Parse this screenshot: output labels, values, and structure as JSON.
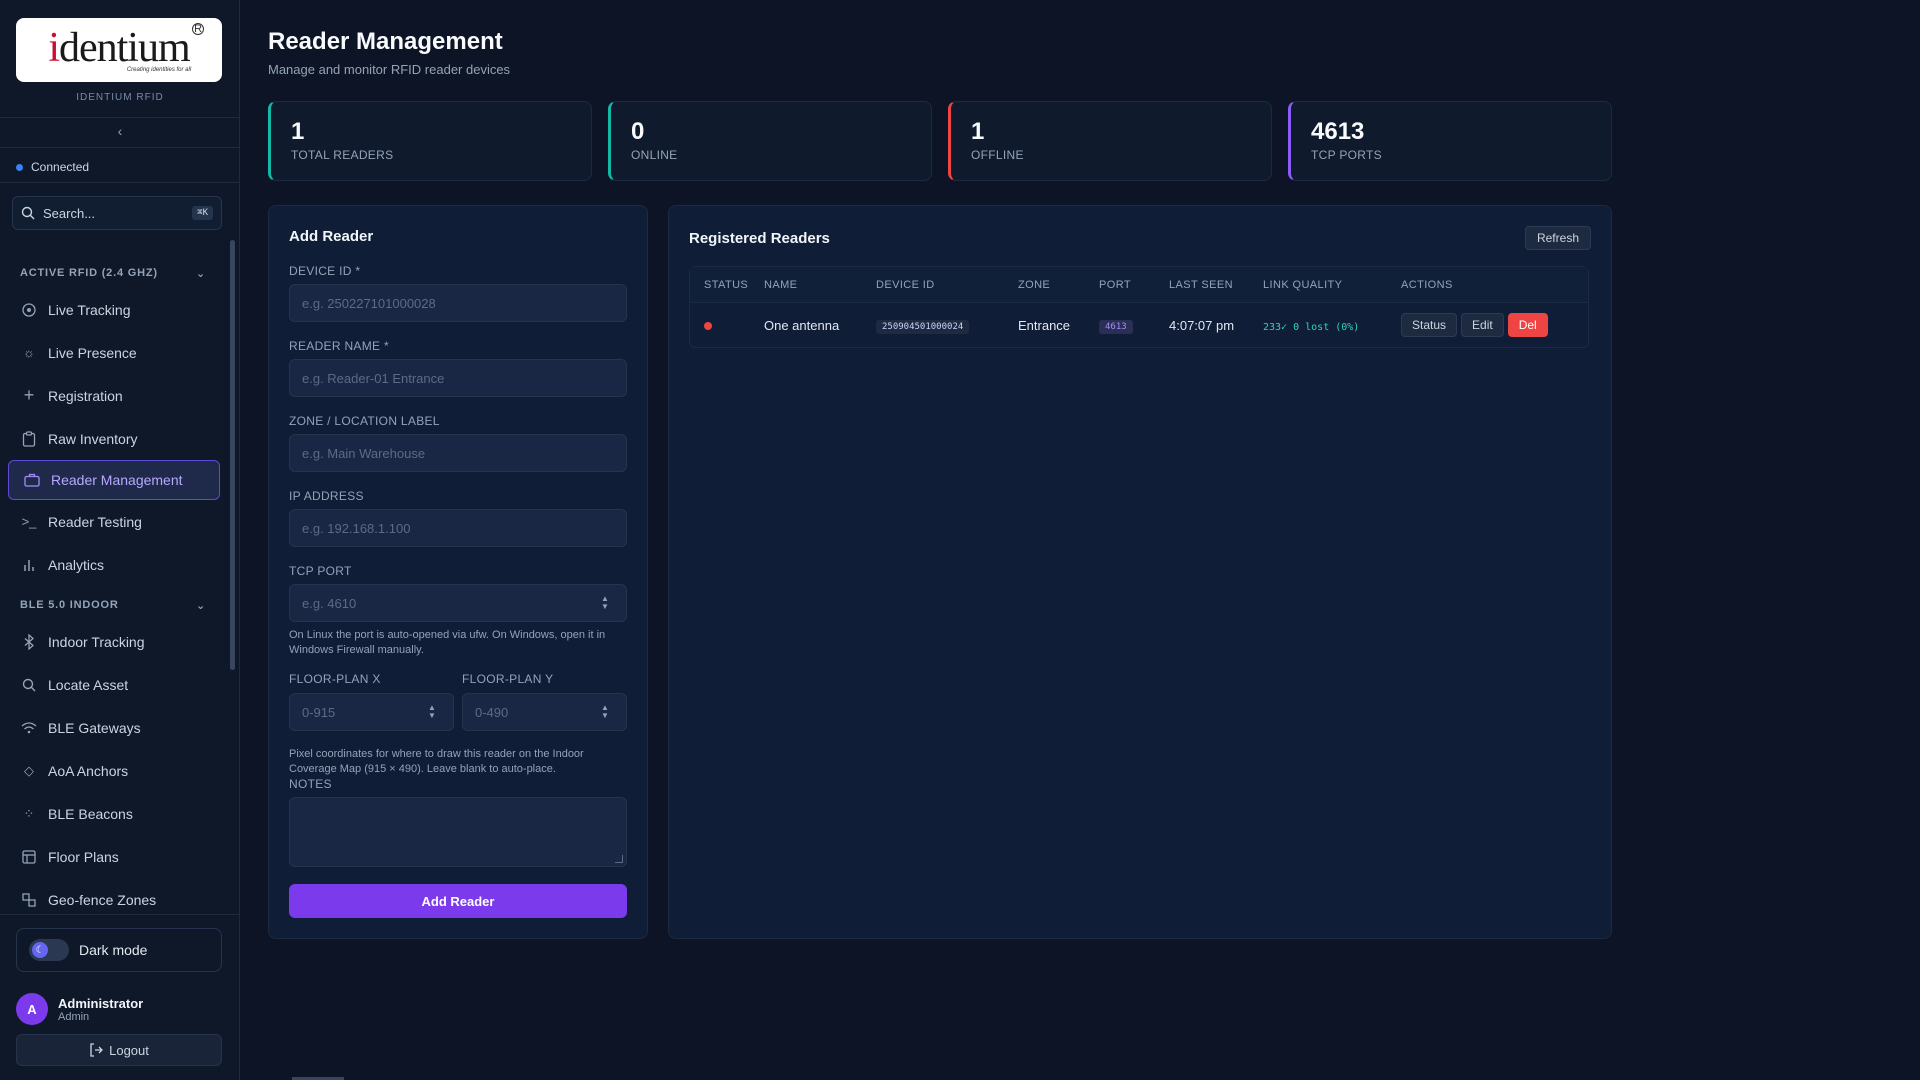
{
  "brand": {
    "logo_prefix": "i",
    "logo_rest": "dentium",
    "logo_reg": "R",
    "tagline": "Creating identities for all",
    "subtitle": "IDENTIUM RFID"
  },
  "sidebar": {
    "collapse_icon": "‹",
    "connection": "Connected",
    "search": {
      "placeholder": "Search...",
      "shortcut": "⌘K"
    },
    "sections": [
      {
        "title": "ACTIVE RFID (2.4 GHZ)",
        "items": [
          {
            "label": "Live Tracking",
            "icon": "radar-icon"
          },
          {
            "label": "Live Presence",
            "icon": "sun-icon"
          },
          {
            "label": "Registration",
            "icon": "plus-icon"
          },
          {
            "label": "Raw Inventory",
            "icon": "clipboard-icon"
          },
          {
            "label": "Reader Management",
            "icon": "briefcase-icon",
            "active": true
          },
          {
            "label": "Reader Testing",
            "icon": "terminal-icon"
          },
          {
            "label": "Analytics",
            "icon": "bar-chart-icon"
          }
        ]
      },
      {
        "title": "BLE 5.0 INDOOR",
        "items": [
          {
            "label": "Indoor Tracking",
            "icon": "bluetooth-icon"
          },
          {
            "label": "Locate Asset",
            "icon": "search-icon"
          },
          {
            "label": "BLE Gateways",
            "icon": "wifi-icon"
          },
          {
            "label": "AoA Anchors",
            "icon": "diamond-icon"
          },
          {
            "label": "BLE Beacons",
            "icon": "beacon-icon"
          },
          {
            "label": "Floor Plans",
            "icon": "layout-icon"
          },
          {
            "label": "Geo-fence Zones",
            "icon": "shapes-icon"
          }
        ]
      }
    ],
    "theme_label": "Dark mode",
    "user": {
      "initial": "A",
      "name": "Administrator",
      "role": "Admin"
    },
    "logout_label": "Logout"
  },
  "header": {
    "title": "Reader Management",
    "subtitle": "Manage and monitor RFID reader devices"
  },
  "stats": [
    {
      "value": "1",
      "label": "TOTAL READERS"
    },
    {
      "value": "0",
      "label": "ONLINE"
    },
    {
      "value": "1",
      "label": "OFFLINE"
    },
    {
      "value": "4613",
      "label": "TCP PORTS"
    }
  ],
  "form": {
    "title": "Add Reader",
    "device_id": {
      "label": "DEVICE ID *",
      "placeholder": "e.g. 250227101000028"
    },
    "reader_name": {
      "label": "READER NAME *",
      "placeholder": "e.g. Reader-01 Entrance"
    },
    "zone": {
      "label": "ZONE / LOCATION LABEL",
      "placeholder": "e.g. Main Warehouse"
    },
    "ip": {
      "label": "IP ADDRESS",
      "placeholder": "e.g. 192.168.1.100"
    },
    "port": {
      "label": "TCP PORT",
      "placeholder": "e.g. 4610",
      "help": "On Linux the port is auto-opened via ufw. On Windows, open it in Windows Firewall manually."
    },
    "floor_x": {
      "label": "FLOOR-PLAN X",
      "placeholder": "0-915"
    },
    "floor_y": {
      "label": "FLOOR-PLAN Y",
      "placeholder": "0-490"
    },
    "floor_help": "Pixel coordinates for where to draw this reader on the Indoor Coverage Map (915 × 490). Leave blank to auto-place.",
    "notes": {
      "label": "NOTES"
    },
    "submit": "Add Reader"
  },
  "readers": {
    "title": "Registered Readers",
    "refresh": "Refresh",
    "columns": [
      "STATUS",
      "NAME",
      "DEVICE ID",
      "ZONE",
      "PORT",
      "LAST SEEN",
      "LINK QUALITY",
      "ACTIONS"
    ],
    "rows": [
      {
        "name": "One antenna",
        "device_id": "250904501000024",
        "zone": "Entrance",
        "port": "4613",
        "last_seen": "4:07:07 pm",
        "link_quality": "233✓ 0 lost (0%)"
      }
    ],
    "actions": {
      "status": "Status",
      "edit": "Edit",
      "del": "Del"
    }
  },
  "colors": {
    "accent": "#7c3aed",
    "online": "#14b8a6",
    "offline": "#ef4444",
    "ports": "#8b5cf6"
  }
}
